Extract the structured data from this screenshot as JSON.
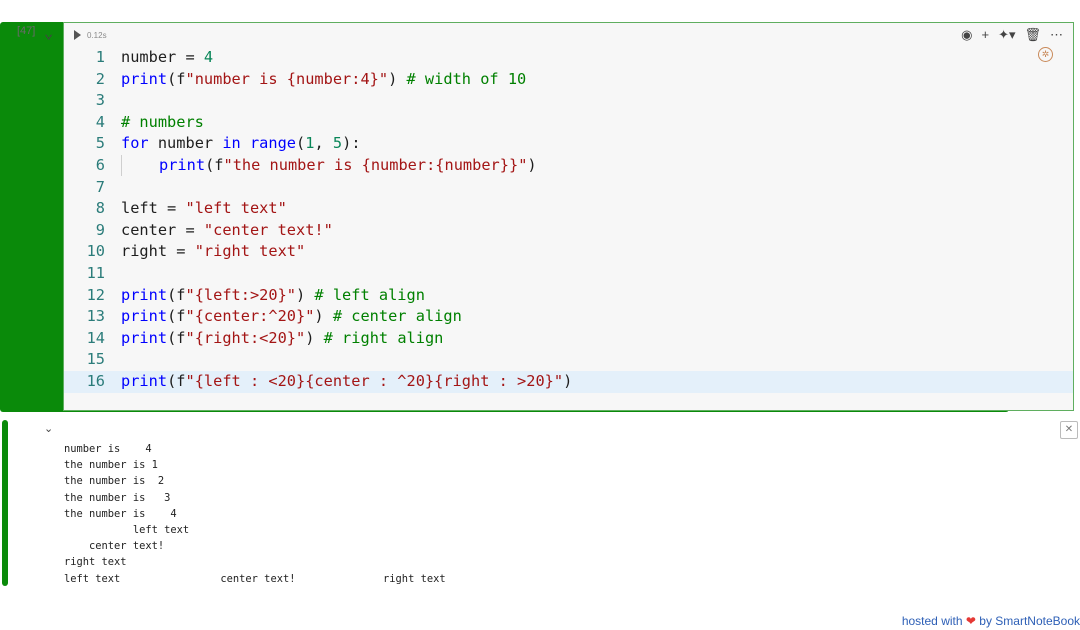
{
  "cell": {
    "execution_count": "[47]",
    "exec_time": "0.12s",
    "code_lines": [
      {
        "num": "1",
        "tokens": [
          {
            "t": "number",
            "c": "pl"
          },
          {
            "t": " = ",
            "c": "op"
          },
          {
            "t": "4",
            "c": "num"
          }
        ]
      },
      {
        "num": "2",
        "tokens": [
          {
            "t": "print",
            "c": "kw"
          },
          {
            "t": "(f",
            "c": "pl"
          },
          {
            "t": "\"number is {number:4}\"",
            "c": "str"
          },
          {
            "t": ") ",
            "c": "pl"
          },
          {
            "t": "# width of 10",
            "c": "cmt"
          }
        ]
      },
      {
        "num": "3",
        "tokens": []
      },
      {
        "num": "4",
        "tokens": [
          {
            "t": "# numbers",
            "c": "cmt"
          }
        ]
      },
      {
        "num": "5",
        "tokens": [
          {
            "t": "for",
            "c": "kw"
          },
          {
            "t": " number ",
            "c": "pl"
          },
          {
            "t": "in",
            "c": "kw"
          },
          {
            "t": " ",
            "c": "pl"
          },
          {
            "t": "range",
            "c": "kw"
          },
          {
            "t": "(",
            "c": "pl"
          },
          {
            "t": "1",
            "c": "num"
          },
          {
            "t": ", ",
            "c": "pl"
          },
          {
            "t": "5",
            "c": "num"
          },
          {
            "t": "):",
            "c": "pl"
          }
        ]
      },
      {
        "num": "6",
        "indent": true,
        "tokens": [
          {
            "t": "print",
            "c": "kw"
          },
          {
            "t": "(f",
            "c": "pl"
          },
          {
            "t": "\"the number is {number:{number}}\"",
            "c": "str"
          },
          {
            "t": ")",
            "c": "pl"
          }
        ]
      },
      {
        "num": "7",
        "tokens": []
      },
      {
        "num": "8",
        "tokens": [
          {
            "t": "left",
            "c": "pl"
          },
          {
            "t": " = ",
            "c": "op"
          },
          {
            "t": "\"left text\"",
            "c": "str"
          }
        ]
      },
      {
        "num": "9",
        "tokens": [
          {
            "t": "center",
            "c": "pl"
          },
          {
            "t": " = ",
            "c": "op"
          },
          {
            "t": "\"center text!\"",
            "c": "str"
          }
        ]
      },
      {
        "num": "10",
        "tokens": [
          {
            "t": "right",
            "c": "pl"
          },
          {
            "t": " = ",
            "c": "op"
          },
          {
            "t": "\"right text\"",
            "c": "str"
          }
        ]
      },
      {
        "num": "11",
        "tokens": []
      },
      {
        "num": "12",
        "tokens": [
          {
            "t": "print",
            "c": "kw"
          },
          {
            "t": "(f",
            "c": "pl"
          },
          {
            "t": "\"{left:>20}\"",
            "c": "str"
          },
          {
            "t": ") ",
            "c": "pl"
          },
          {
            "t": "# left align",
            "c": "cmt"
          }
        ]
      },
      {
        "num": "13",
        "tokens": [
          {
            "t": "print",
            "c": "kw"
          },
          {
            "t": "(f",
            "c": "pl"
          },
          {
            "t": "\"{center:^20}\"",
            "c": "str"
          },
          {
            "t": ") ",
            "c": "pl"
          },
          {
            "t": "# center align",
            "c": "cmt"
          }
        ]
      },
      {
        "num": "14",
        "tokens": [
          {
            "t": "print",
            "c": "kw"
          },
          {
            "t": "(f",
            "c": "pl"
          },
          {
            "t": "\"{right:<20}\"",
            "c": "str"
          },
          {
            "t": ") ",
            "c": "pl"
          },
          {
            "t": "# right align",
            "c": "cmt"
          }
        ]
      },
      {
        "num": "15",
        "tokens": []
      },
      {
        "num": "16",
        "active": true,
        "tokens": [
          {
            "t": "print",
            "c": "kw"
          },
          {
            "t": "(f",
            "c": "pl"
          },
          {
            "t": "\"{left : <20}{center : ^20}{right : >20}\"",
            "c": "str"
          },
          {
            "t": ")",
            "c": "pl"
          }
        ]
      }
    ],
    "toolbar": {
      "preview_icon": "eye-icon",
      "add_icon": "plus-icon",
      "python_icon": "python-icon",
      "delete_icon": "trash-icon",
      "more_icon": "ellipsis-icon"
    }
  },
  "output": {
    "lines": [
      "number is    4",
      "the number is 1",
      "the number is  2",
      "the number is   3",
      "the number is    4",
      "           left text",
      "    center text!",
      "right text",
      "left text                center text!              right text"
    ]
  },
  "footer": {
    "prefix": "hosted with",
    "heart": "❤",
    "suffix": "by SmartNoteBook"
  },
  "colors": {
    "exec_bar": "#0a8a0a",
    "cell_border": "#5fae5f",
    "keyword": "#0000ff",
    "string": "#a31515",
    "comment": "#008000",
    "number": "#098658",
    "line_number": "#2b7c7a",
    "footer_link": "#2d5fb6"
  }
}
